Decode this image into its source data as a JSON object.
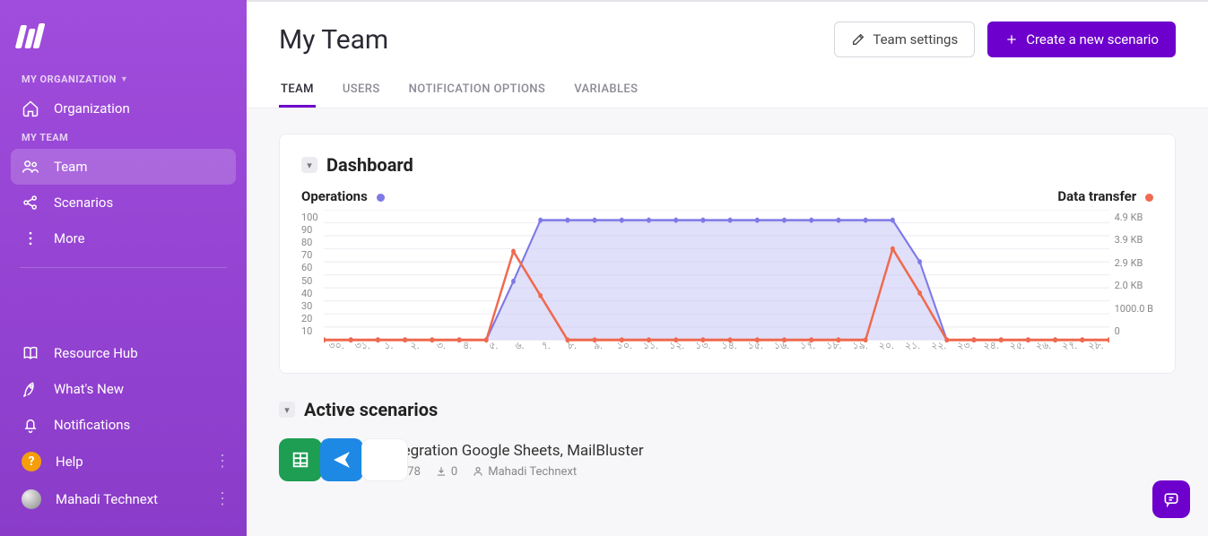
{
  "sidebar": {
    "section_org_label": "MY ORGANIZATION",
    "org_item": "Organization",
    "section_team_label": "MY TEAM",
    "team_item": "Team",
    "scenarios_item": "Scenarios",
    "more_item": "More",
    "resource_item": "Resource Hub",
    "whatsnew_item": "What's New",
    "notifications_item": "Notifications",
    "help_item": "Help",
    "user_name": "Mahadi Technext"
  },
  "header": {
    "title": "My Team",
    "settings_btn": "Team settings",
    "create_btn": "Create a new scenario"
  },
  "tabs": [
    "TEAM",
    "USERS",
    "NOTIFICATION OPTIONS",
    "VARIABLES"
  ],
  "dashboard": {
    "title": "Dashboard",
    "legend_ops": "Operations",
    "legend_data": "Data transfer"
  },
  "chart_data": {
    "type": "line",
    "categories": [
      "৩০.",
      "৩১.",
      "১.",
      "২.",
      "৩.",
      "৪.",
      "৫.",
      "৬.",
      "৭.",
      "৮.",
      "৯.",
      "১০.",
      "১১.",
      "১২.",
      "১৩.",
      "১৪.",
      "১৫.",
      "১৬.",
      "১৭.",
      "১৮.",
      "১৯.",
      "২০.",
      "২১.",
      "২২.",
      "২৩.",
      "২৪.",
      "২৫.",
      "২৬.",
      "২৭.",
      "২৮."
    ],
    "y_left_ticks": [
      "100",
      "90",
      "80",
      "70",
      "60",
      "50",
      "40",
      "30",
      "20",
      "10"
    ],
    "y_right_ticks": [
      "4.9 KB",
      "3.9 KB",
      "2.9 KB",
      "2.0 KB",
      "1000.0 B",
      "0"
    ],
    "series": [
      {
        "name": "Operations",
        "color": "#7e79e6",
        "values": [
          0,
          0,
          0,
          0,
          0,
          0,
          0,
          45,
          92,
          92,
          92,
          92,
          92,
          92,
          92,
          92,
          92,
          92,
          92,
          92,
          92,
          92,
          60,
          0,
          0,
          0,
          0,
          0,
          0,
          0
        ]
      },
      {
        "name": "Data transfer",
        "color": "#ef6a4f",
        "values": [
          0,
          0,
          0,
          0,
          0,
          0,
          0,
          68,
          34,
          0,
          0,
          0,
          0,
          0,
          0,
          0,
          0,
          0,
          0,
          0,
          0,
          70,
          36,
          0,
          0,
          0,
          0,
          0,
          0,
          0
        ]
      }
    ],
    "xlabel": "",
    "ylabel": "",
    "ylim_left": [
      0,
      100
    ],
    "ylim_right": [
      0,
      4.9
    ]
  },
  "active_scenarios": {
    "title": "Active scenarios",
    "items": [
      {
        "title": "Integration Google Sheets, MailBluster",
        "ops": "978",
        "transfers": "0",
        "owner": "Mahadi Technext"
      }
    ]
  }
}
